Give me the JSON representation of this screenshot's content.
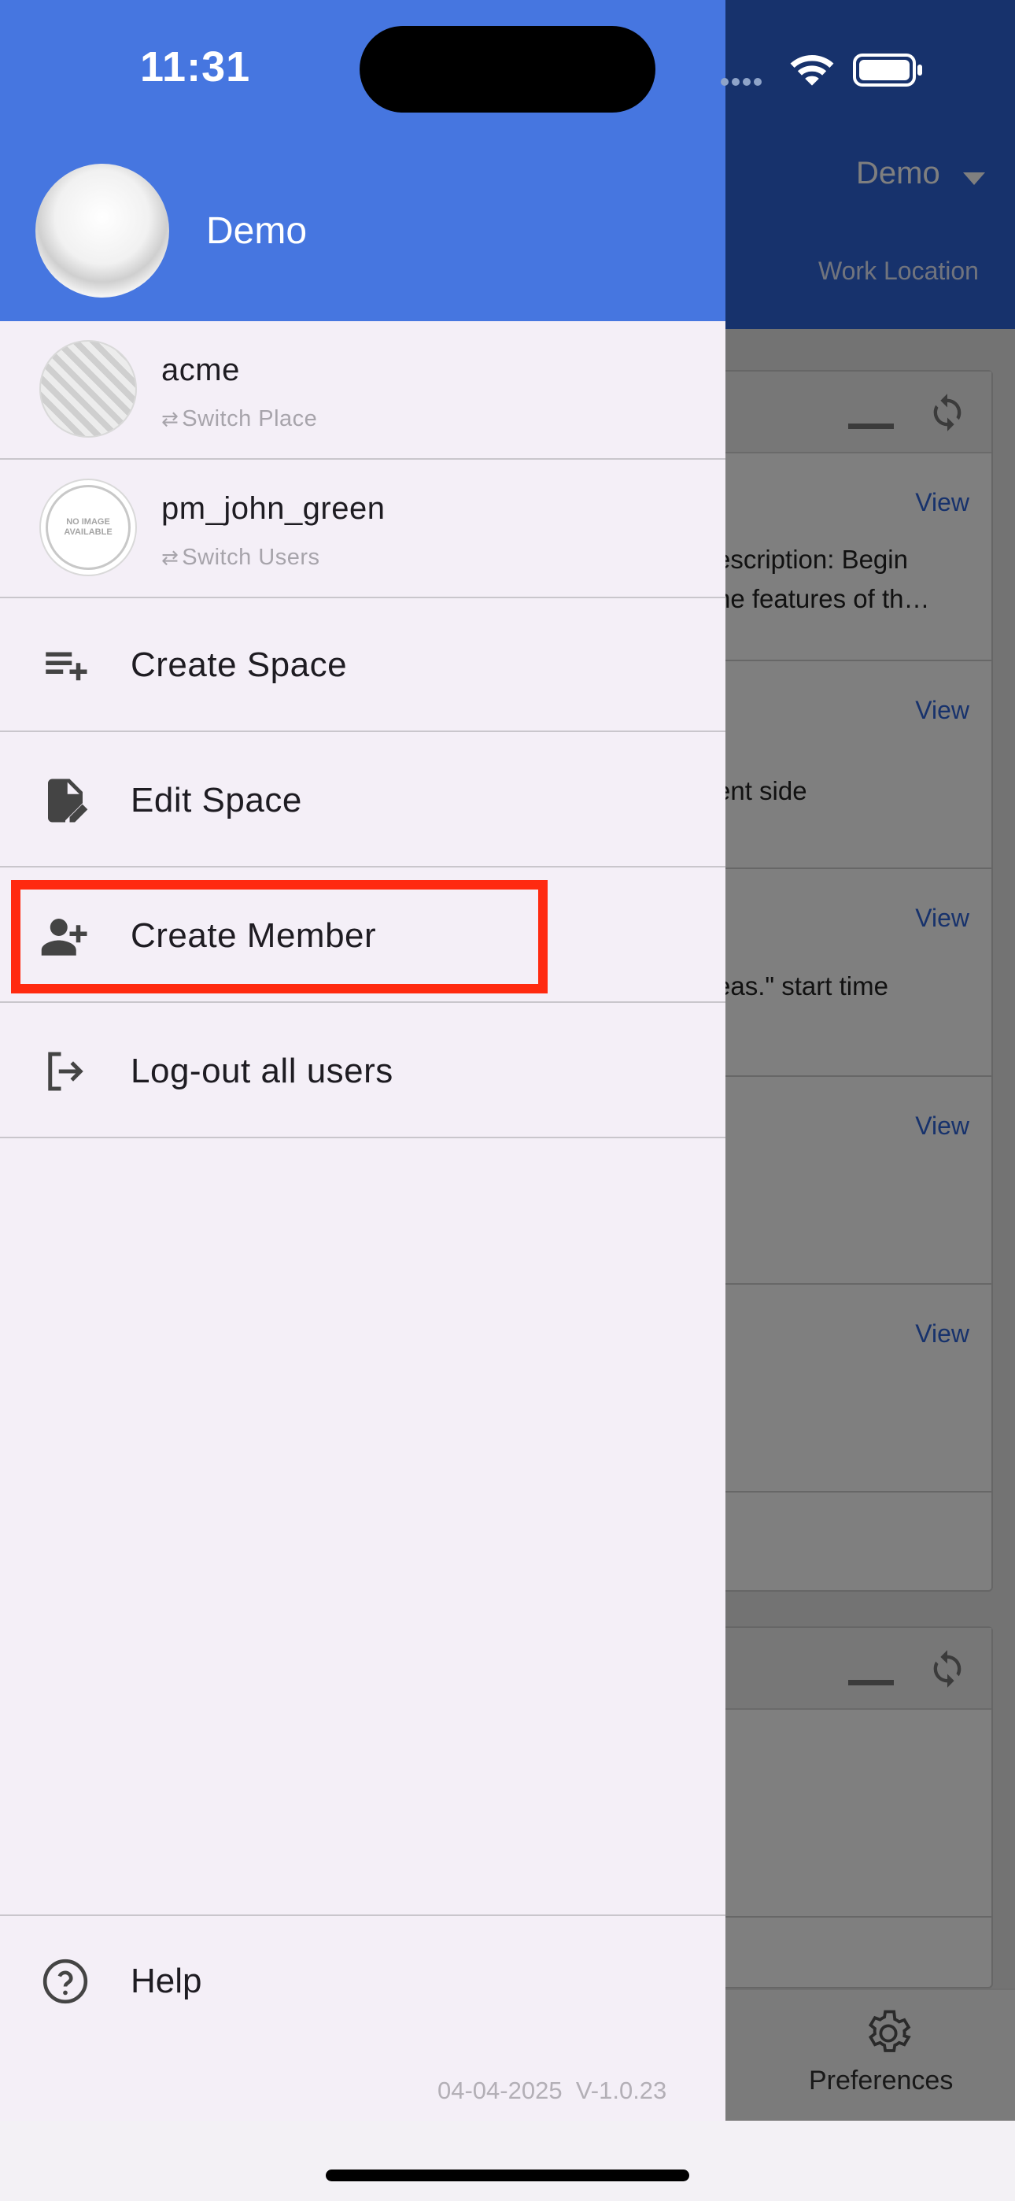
{
  "status_bar": {
    "time": "11:31"
  },
  "background": {
    "header_user": "Demo",
    "header_sub": "Work Location",
    "items": [
      {
        "view": "View",
        "desc_1": "escription: Begin",
        "desc_2": "ne features of th…"
      },
      {
        "view": "View",
        "desc_1": "ent side",
        "desc_2": ""
      },
      {
        "view": "View",
        "desc_1": "eas.\" start time",
        "desc_2": ""
      },
      {
        "view": "View",
        "desc_1": "",
        "desc_2": ""
      },
      {
        "view": "View",
        "desc_1": "",
        "desc_2": ""
      }
    ],
    "bottom_tab": "Preferences"
  },
  "drawer": {
    "profile_name": "Demo",
    "accounts": [
      {
        "title": "acme",
        "subtitle": "Switch Place"
      },
      {
        "title": "pm_john_green",
        "subtitle": "Switch Users",
        "avatar_text": "NO IMAGE AVAILABLE"
      }
    ],
    "menu": [
      {
        "label": "Create Space",
        "icon": "playlist-add-icon"
      },
      {
        "label": "Edit Space",
        "icon": "edit-document-icon"
      },
      {
        "label": "Create Member",
        "icon": "person-add-icon"
      },
      {
        "label": "Log-out all users",
        "icon": "logout-icon"
      }
    ],
    "help": "Help",
    "version_date": "04-04-2025",
    "version": "V-1.0.23"
  },
  "colors": {
    "drawer_header": "#4676e0",
    "highlight": "#ff2a10",
    "drawer_bg": "#f4eff7"
  }
}
